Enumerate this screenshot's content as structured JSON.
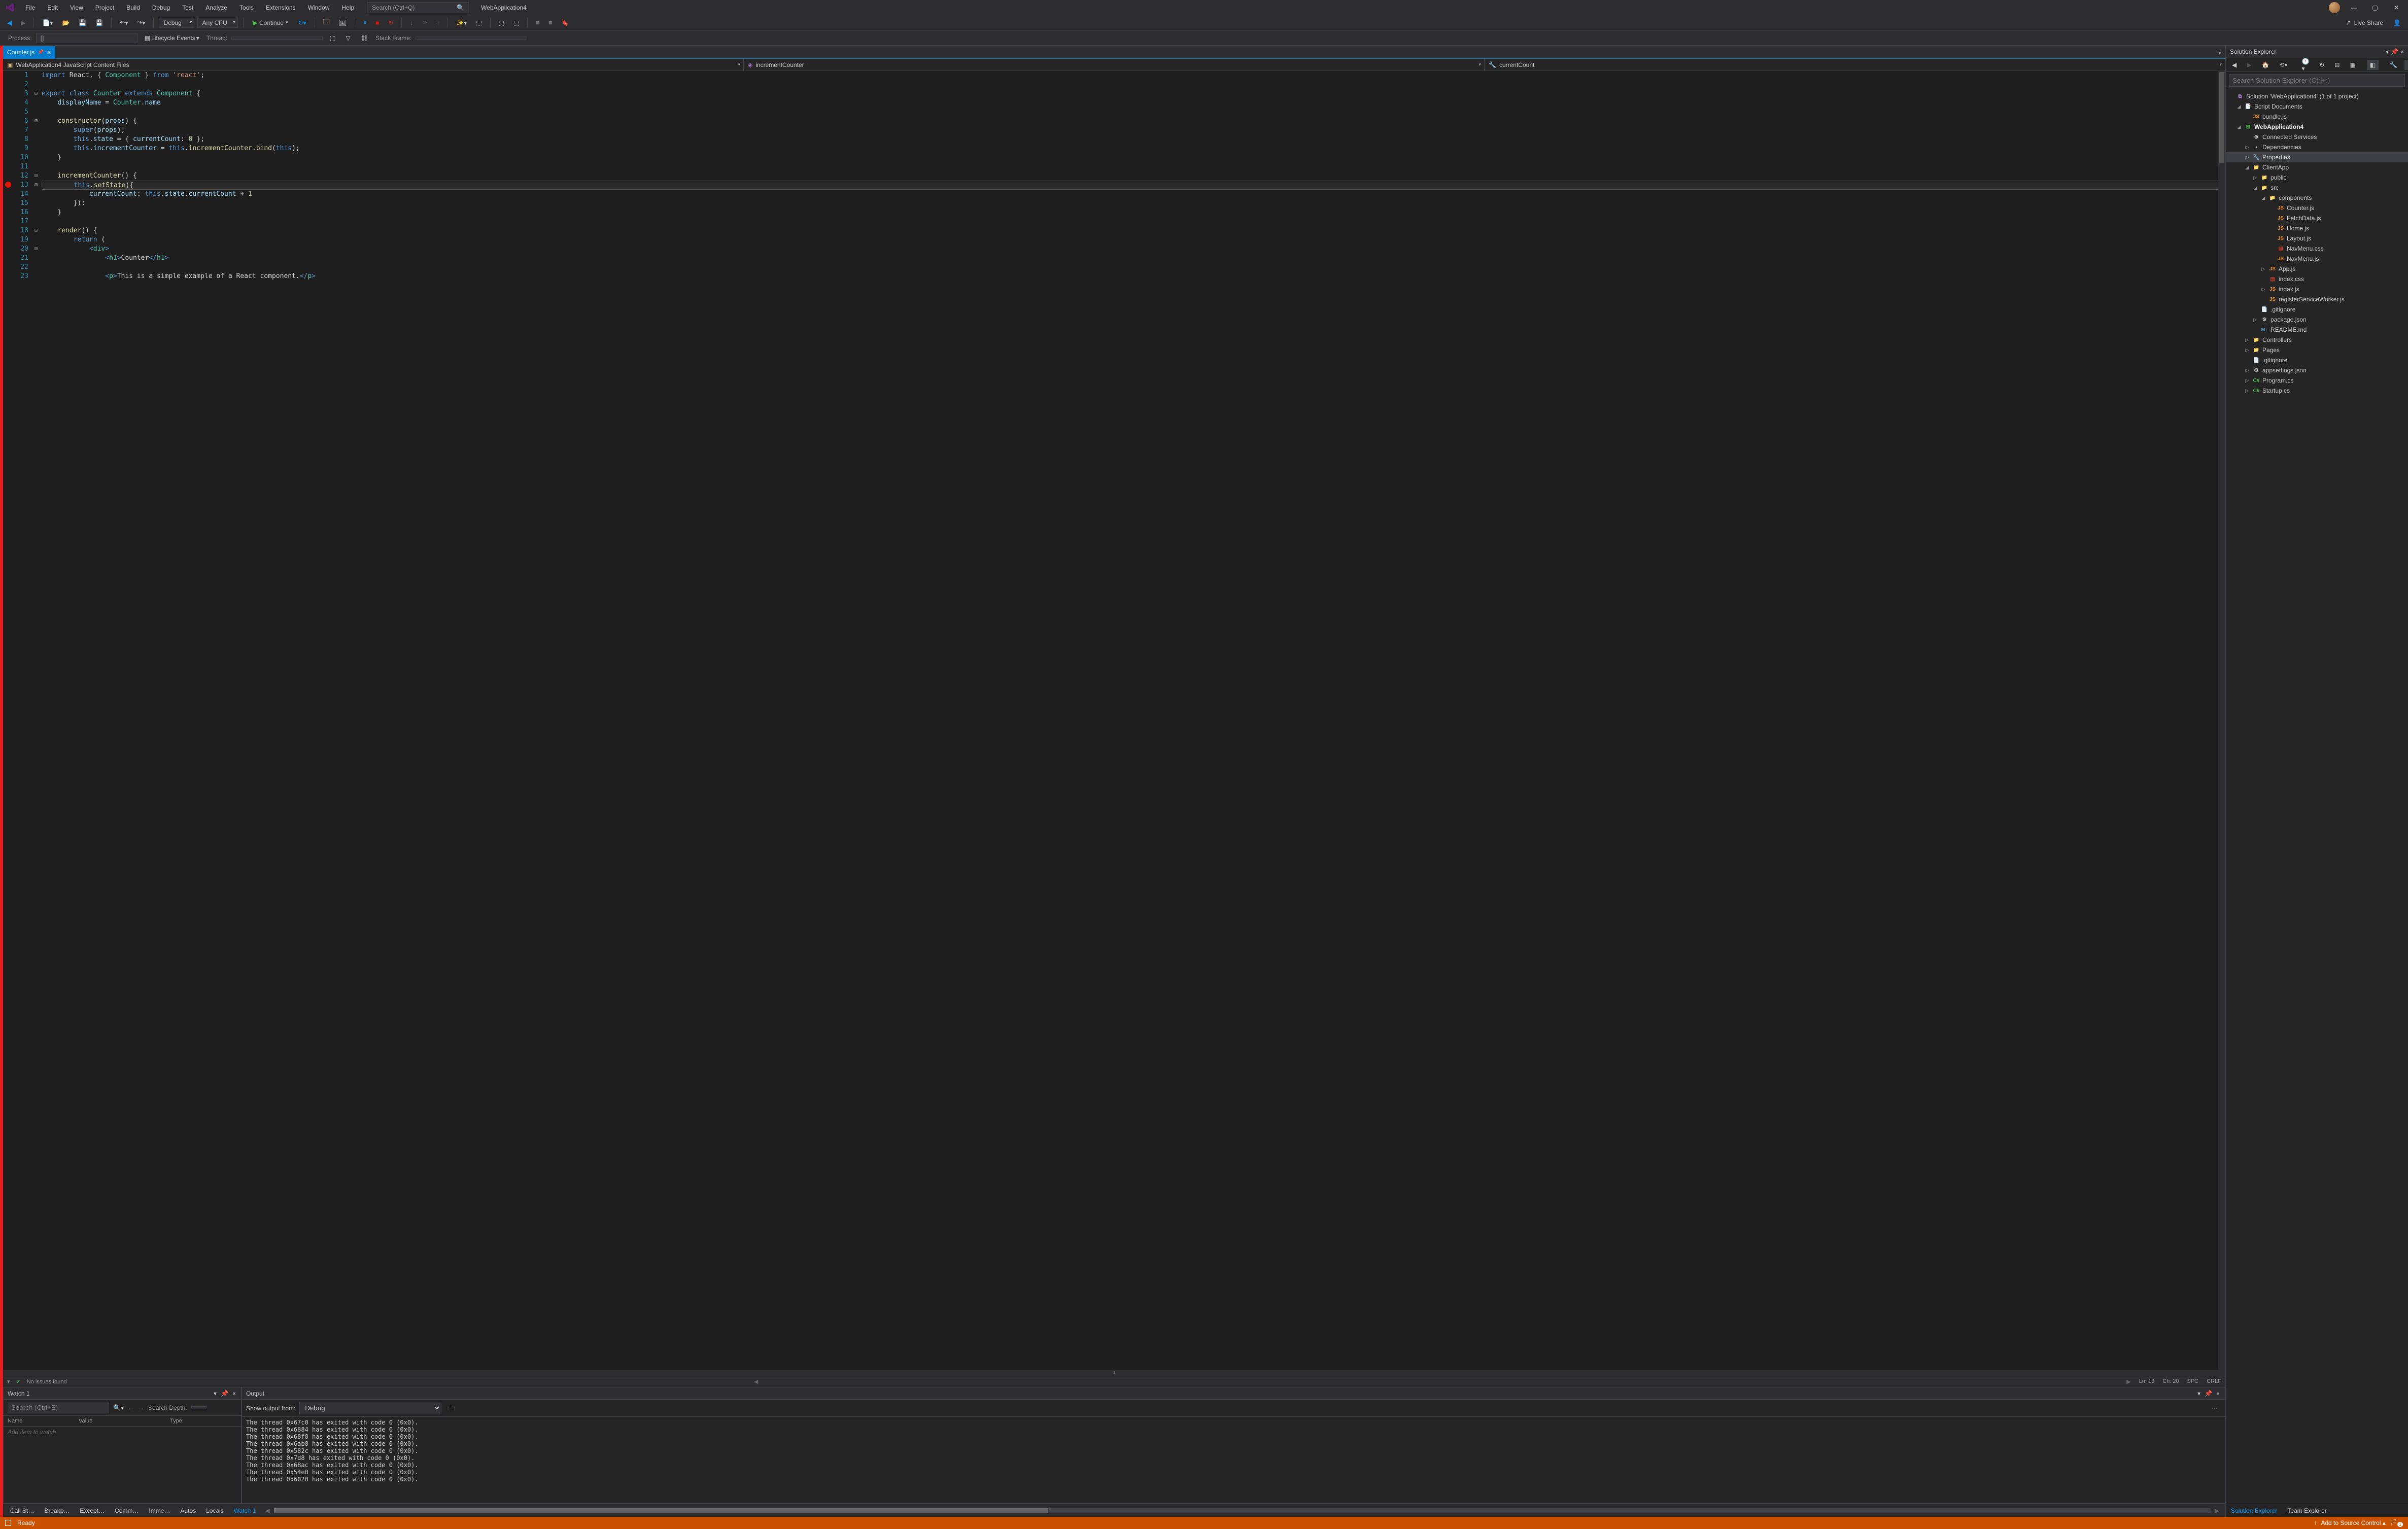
{
  "menu": [
    "File",
    "Edit",
    "View",
    "Project",
    "Build",
    "Debug",
    "Test",
    "Analyze",
    "Tools",
    "Extensions",
    "Window",
    "Help"
  ],
  "search_placeholder": "Search (Ctrl+Q)",
  "app_title": "WebApplication4",
  "toolbar": {
    "config": "Debug",
    "platform": "Any CPU",
    "continue": "Continue",
    "live_share": "Live Share"
  },
  "toolbar2": {
    "process_label": "Process:",
    "process_value": "[]",
    "lifecycle": "Lifecycle Events",
    "thread": "Thread:",
    "stack": "Stack Frame:"
  },
  "tab": {
    "name": "Counter.js"
  },
  "nav": {
    "scope": "WebApplication4 JavaScript Content Files",
    "member1": "incrementCounter",
    "member2": "currentCount"
  },
  "code": {
    "lines": [
      {
        "n": 1,
        "fold": "",
        "segs": [
          [
            "",
            ""
          ],
          [
            "kw",
            "import"
          ],
          [
            "txt",
            " React, { "
          ],
          [
            "cls",
            "Component"
          ],
          [
            "txt",
            " } "
          ],
          [
            "kw",
            "from"
          ],
          [
            "txt",
            " "
          ],
          [
            "str",
            "'react'"
          ],
          [
            "txt",
            ";"
          ]
        ]
      },
      {
        "n": 2,
        "fold": "",
        "segs": []
      },
      {
        "n": 3,
        "fold": "⊟",
        "segs": [
          [
            "kw",
            "export"
          ],
          [
            "txt",
            " "
          ],
          [
            "kw",
            "class"
          ],
          [
            "txt",
            " "
          ],
          [
            "cls",
            "Counter"
          ],
          [
            "txt",
            " "
          ],
          [
            "kw",
            "extends"
          ],
          [
            "txt",
            " "
          ],
          [
            "cls",
            "Component"
          ],
          [
            "txt",
            " {"
          ]
        ]
      },
      {
        "n": 4,
        "fold": "",
        "segs": [
          [
            "txt",
            "    "
          ],
          [
            "prop",
            "displayName"
          ],
          [
            "txt",
            " = "
          ],
          [
            "cls",
            "Counter"
          ],
          [
            "txt",
            "."
          ],
          [
            "prop",
            "name"
          ]
        ]
      },
      {
        "n": 5,
        "fold": "",
        "segs": []
      },
      {
        "n": 6,
        "fold": "⊟",
        "segs": [
          [
            "txt",
            "    "
          ],
          [
            "fn",
            "constructor"
          ],
          [
            "txt",
            "("
          ],
          [
            "prop",
            "props"
          ],
          [
            "txt",
            ") {"
          ]
        ]
      },
      {
        "n": 7,
        "fold": "",
        "segs": [
          [
            "txt",
            "        "
          ],
          [
            "kw",
            "super"
          ],
          [
            "txt",
            "("
          ],
          [
            "prop",
            "props"
          ],
          [
            "txt",
            ");"
          ]
        ]
      },
      {
        "n": 8,
        "fold": "",
        "segs": [
          [
            "txt",
            "        "
          ],
          [
            "kw",
            "this"
          ],
          [
            "txt",
            "."
          ],
          [
            "prop",
            "state"
          ],
          [
            "txt",
            " = { "
          ],
          [
            "prop",
            "currentCount"
          ],
          [
            "txt",
            ": "
          ],
          [
            "num",
            "0"
          ],
          [
            "txt",
            " };"
          ]
        ]
      },
      {
        "n": 9,
        "fold": "",
        "segs": [
          [
            "txt",
            "        "
          ],
          [
            "kw",
            "this"
          ],
          [
            "txt",
            "."
          ],
          [
            "prop",
            "incrementCounter"
          ],
          [
            "txt",
            " = "
          ],
          [
            "kw",
            "this"
          ],
          [
            "txt",
            "."
          ],
          [
            "fn",
            "incrementCounter"
          ],
          [
            "txt",
            "."
          ],
          [
            "fn",
            "bind"
          ],
          [
            "txt",
            "("
          ],
          [
            "kw",
            "this"
          ],
          [
            "txt",
            ");"
          ]
        ]
      },
      {
        "n": 10,
        "fold": "",
        "segs": [
          [
            "txt",
            "    }"
          ]
        ]
      },
      {
        "n": 11,
        "fold": "",
        "segs": []
      },
      {
        "n": 12,
        "fold": "⊟",
        "segs": [
          [
            "txt",
            "    "
          ],
          [
            "fn",
            "incrementCounter"
          ],
          [
            "txt",
            "() {"
          ]
        ]
      },
      {
        "n": 13,
        "fold": "⊟",
        "hl": true,
        "bp": true,
        "segs": [
          [
            "txt",
            "        "
          ],
          [
            "kw",
            "this"
          ],
          [
            "txt",
            "."
          ],
          [
            "fn",
            "setState"
          ],
          [
            "txt",
            "({"
          ]
        ]
      },
      {
        "n": 14,
        "fold": "",
        "segs": [
          [
            "txt",
            "            "
          ],
          [
            "prop",
            "currentCount"
          ],
          [
            "txt",
            ": "
          ],
          [
            "kw",
            "this"
          ],
          [
            "txt",
            "."
          ],
          [
            "prop",
            "state"
          ],
          [
            "txt",
            "."
          ],
          [
            "prop",
            "currentCount"
          ],
          [
            "txt",
            " + "
          ],
          [
            "num",
            "1"
          ]
        ]
      },
      {
        "n": 15,
        "fold": "",
        "segs": [
          [
            "txt",
            "        });"
          ]
        ]
      },
      {
        "n": 16,
        "fold": "",
        "segs": [
          [
            "txt",
            "    }"
          ]
        ]
      },
      {
        "n": 17,
        "fold": "",
        "segs": []
      },
      {
        "n": 18,
        "fold": "⊟",
        "segs": [
          [
            "txt",
            "    "
          ],
          [
            "fn",
            "render"
          ],
          [
            "txt",
            "() {"
          ]
        ]
      },
      {
        "n": 19,
        "fold": "",
        "segs": [
          [
            "txt",
            "        "
          ],
          [
            "kw",
            "return"
          ],
          [
            "txt",
            " ("
          ]
        ]
      },
      {
        "n": 20,
        "fold": "⊟",
        "segs": [
          [
            "txt",
            "            "
          ],
          [
            "tag",
            "<"
          ],
          [
            "tagname",
            "div"
          ],
          [
            "tag",
            ">"
          ]
        ]
      },
      {
        "n": 21,
        "fold": "",
        "segs": [
          [
            "txt",
            "                "
          ],
          [
            "tag",
            "<"
          ],
          [
            "tagname",
            "h1"
          ],
          [
            "tag",
            ">"
          ],
          [
            "txt",
            "Counter"
          ],
          [
            "tag",
            "</"
          ],
          [
            "tagname",
            "h1"
          ],
          [
            "tag",
            ">"
          ]
        ]
      },
      {
        "n": 22,
        "fold": "",
        "segs": []
      },
      {
        "n": 23,
        "fold": "",
        "segs": [
          [
            "txt",
            "                "
          ],
          [
            "tag",
            "<"
          ],
          [
            "tagname",
            "p"
          ],
          [
            "tag",
            ">"
          ],
          [
            "txt",
            "This is a simple example of a React component."
          ],
          [
            "tag",
            "</"
          ],
          [
            "tagname",
            "p"
          ],
          [
            "tag",
            ">"
          ]
        ]
      }
    ]
  },
  "editor_status": {
    "issues": "No issues found",
    "ln": "Ln: 13",
    "ch": "Ch: 20",
    "spc": "SPC",
    "eol": "CRLF"
  },
  "watch": {
    "title": "Watch 1",
    "search_placeholder": "Search (Ctrl+E)",
    "depth_label": "Search Depth:",
    "cols": [
      "Name",
      "Value",
      "Type"
    ],
    "placeholder": "Add item to watch"
  },
  "output": {
    "title": "Output",
    "from_label": "Show output from:",
    "from_value": "Debug",
    "lines": [
      "The thread 0x67c0 has exited with code 0 (0x0).",
      "The thread 0x6884 has exited with code 0 (0x0).",
      "The thread 0x68f8 has exited with code 0 (0x0).",
      "The thread 0x6ab8 has exited with code 0 (0x0).",
      "The thread 0x582c has exited with code 0 (0x0).",
      "The thread 0x7d8 has exited with code 0 (0x0).",
      "The thread 0x68ac has exited with code 0 (0x0).",
      "The thread 0x54e0 has exited with code 0 (0x0).",
      "The thread 0x6020 has exited with code 0 (0x0)."
    ]
  },
  "bottom_tabs": [
    "Call St…",
    "Breakp…",
    "Except…",
    "Comm…",
    "Imme…",
    "Autos",
    "Locals",
    "Watch 1"
  ],
  "solution": {
    "title": "Solution Explorer",
    "search_placeholder": "Search Solution Explorer (Ctrl+;)",
    "tree": [
      {
        "d": 0,
        "exp": "",
        "icon": "sln",
        "label": "Solution 'WebApplication4' (1 of 1 project)"
      },
      {
        "d": 1,
        "exp": "◢",
        "icon": "scriptdoc",
        "label": "Script Documents"
      },
      {
        "d": 2,
        "exp": "",
        "icon": "js",
        "label": "bundle.js"
      },
      {
        "d": 1,
        "exp": "◢",
        "icon": "proj",
        "label": "WebApplication4",
        "bold": true
      },
      {
        "d": 2,
        "exp": "",
        "icon": "connected",
        "label": "Connected Services"
      },
      {
        "d": 2,
        "exp": "▷",
        "icon": "ref",
        "label": "Dependencies"
      },
      {
        "d": 2,
        "exp": "▷",
        "icon": "wrench",
        "label": "Properties",
        "selected": true
      },
      {
        "d": 2,
        "exp": "◢",
        "icon": "folder",
        "label": "ClientApp"
      },
      {
        "d": 3,
        "exp": "▷",
        "icon": "folder",
        "label": "public"
      },
      {
        "d": 3,
        "exp": "◢",
        "icon": "folder",
        "label": "src"
      },
      {
        "d": 4,
        "exp": "◢",
        "icon": "folder",
        "label": "components"
      },
      {
        "d": 5,
        "exp": "",
        "icon": "js",
        "label": "Counter.js"
      },
      {
        "d": 5,
        "exp": "",
        "icon": "js",
        "label": "FetchData.js"
      },
      {
        "d": 5,
        "exp": "",
        "icon": "js",
        "label": "Home.js"
      },
      {
        "d": 5,
        "exp": "",
        "icon": "js",
        "label": "Layout.js"
      },
      {
        "d": 5,
        "exp": "",
        "icon": "css",
        "label": "NavMenu.css"
      },
      {
        "d": 5,
        "exp": "",
        "icon": "js",
        "label": "NavMenu.js"
      },
      {
        "d": 4,
        "exp": "▷",
        "icon": "js",
        "label": "App.js"
      },
      {
        "d": 4,
        "exp": "",
        "icon": "css",
        "label": "index.css"
      },
      {
        "d": 4,
        "exp": "▷",
        "icon": "js",
        "label": "index.js"
      },
      {
        "d": 4,
        "exp": "",
        "icon": "js",
        "label": "registerServiceWorker.js"
      },
      {
        "d": 3,
        "exp": "",
        "icon": "file",
        "label": ".gitignore"
      },
      {
        "d": 3,
        "exp": "▷",
        "icon": "json",
        "label": "package.json"
      },
      {
        "d": 3,
        "exp": "",
        "icon": "md",
        "label": "README.md"
      },
      {
        "d": 2,
        "exp": "▷",
        "icon": "folder",
        "label": "Controllers"
      },
      {
        "d": 2,
        "exp": "▷",
        "icon": "folder",
        "label": "Pages"
      },
      {
        "d": 2,
        "exp": "",
        "icon": "file",
        "label": ".gitignore"
      },
      {
        "d": 2,
        "exp": "▷",
        "icon": "json",
        "label": "appsettings.json"
      },
      {
        "d": 2,
        "exp": "▷",
        "icon": "cs",
        "label": "Program.cs"
      },
      {
        "d": 2,
        "exp": "▷",
        "icon": "cs",
        "label": "Startup.cs"
      }
    ],
    "bottom_tabs": [
      "Solution Explorer",
      "Team Explorer"
    ]
  },
  "statusbar": {
    "ready": "Ready",
    "source_control": "Add to Source Control"
  }
}
